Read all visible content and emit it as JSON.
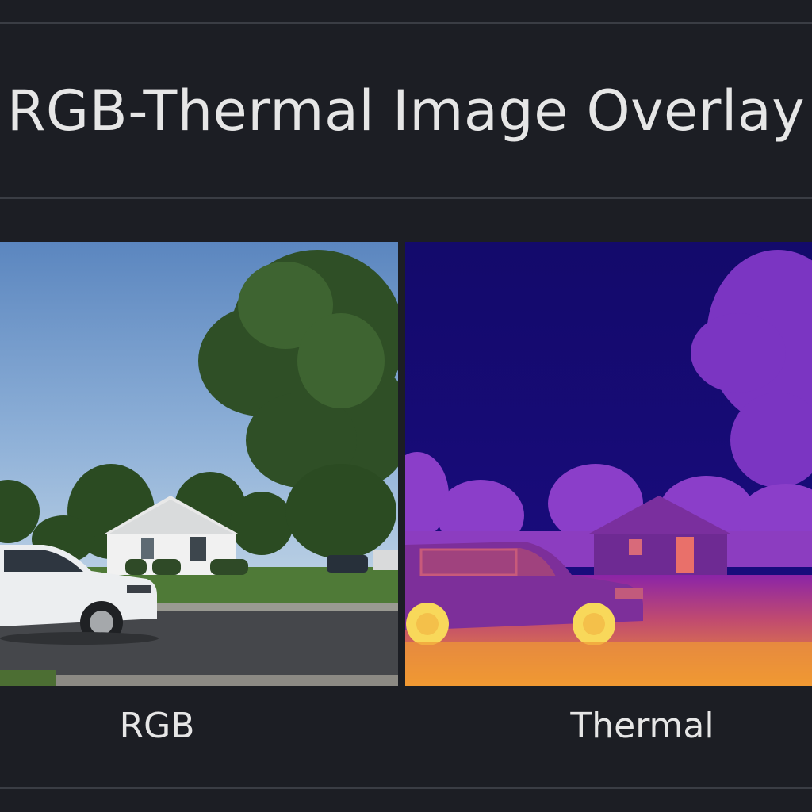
{
  "header": {
    "title": "RGB-Thermal Image Overlay"
  },
  "panels": [
    {
      "label": "RGB",
      "image": "rgb-photo-suburban-house-car"
    },
    {
      "label": "Thermal",
      "image": "thermal-photo-suburban-house-car"
    }
  ],
  "colors": {
    "background": "#1c1e24",
    "divider": "#3a3d44",
    "text": "#e6e6e6"
  }
}
